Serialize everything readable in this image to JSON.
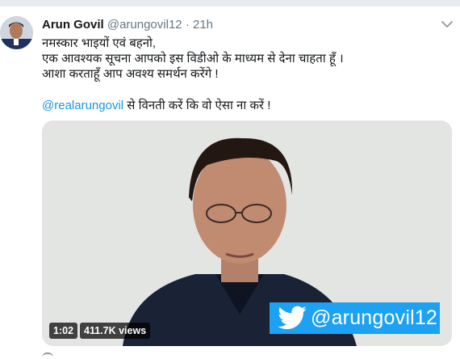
{
  "tweet": {
    "author_name": "Arun Govil",
    "author_handle": "@arungovil12",
    "separator": "·",
    "timestamp": "21h",
    "text_lines": [
      "नमस्कार भाइयों एवं बहनो,",
      "एक आवश्यक सूचना आपको इस विडीओ के माध्यम से देना चाहता हूँ ।",
      "आशा करताहूँ आप अवश्य समर्थन करेंगे !"
    ],
    "mention": "@realarungovil",
    "mention_suffix": " से विनती करें कि वो ऐसा ना करें !"
  },
  "video": {
    "brand_handle": "@arungovil12",
    "duration": "1:02",
    "views": "411.7K views"
  },
  "colors": {
    "link": "#1b95e0",
    "twitter_blue": "#1da1f2",
    "secondary_text": "#657786"
  },
  "icons": [
    "chevron-down-icon",
    "twitter-bird-icon"
  ]
}
